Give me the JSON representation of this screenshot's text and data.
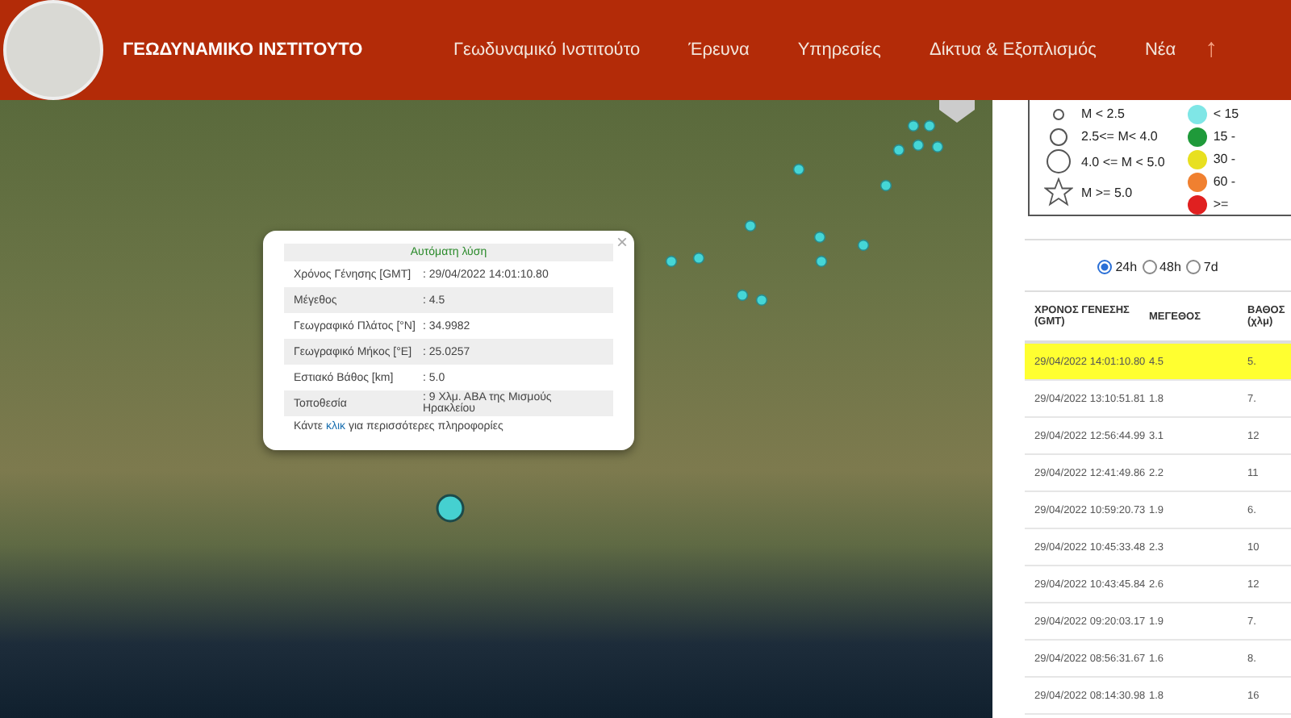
{
  "header": {
    "title": "ΓΕΩΔΥΝΑΜΙΚΟ ΙΝΣΤΙΤΟΥΤΟ",
    "nav": [
      "Γεωδυναμικό Ινστιτούτο",
      "Έρευνα",
      "Υπηρεσίες",
      "Δίκτυα & Εξοπλισμός",
      "Νέα"
    ],
    "up_arrow": "↑"
  },
  "popup": {
    "close": "×",
    "heading": "Αυτόματη λύση",
    "rows": [
      {
        "label": "Χρόνος Γένησης [GMT]",
        "value": ": 29/04/2022 14:01:10.80"
      },
      {
        "label": "Μέγεθος",
        "value": ": 4.5"
      },
      {
        "label": "Γεωγραφικό Πλάτος [°N]",
        "value": ": 34.9982"
      },
      {
        "label": "Γεωγραφικό Μήκος [°E]",
        "value": ": 25.0257"
      },
      {
        "label": "Εστιακό Βάθος [km]",
        "value": ": 5.0"
      },
      {
        "label": "Τοποθεσία",
        "value": ": 9 Χλμ. ΑΒΑ της Μισμούς Ηρακλείου"
      }
    ],
    "footer_before": "Κάντε ",
    "footer_link": "κλικ",
    "footer_after": " για περισσότερες πληροφορίες"
  },
  "legend": {
    "sizes": [
      {
        "kind": "small",
        "label": "M < 2.5"
      },
      {
        "kind": "medium",
        "label": "2.5<= M< 4.0"
      },
      {
        "kind": "large",
        "label": "4.0 <= M < 5.0"
      },
      {
        "kind": "star",
        "label": "M >= 5.0"
      }
    ],
    "depths": [
      {
        "label": "< 15",
        "color": "#7fe6e6"
      },
      {
        "label": "15 -",
        "color": "#1f9a3a"
      },
      {
        "label": "30 -",
        "color": "#e8e020"
      },
      {
        "label": "60 -",
        "color": "#f08030"
      },
      {
        "label": ">=",
        "color": "#e02020"
      }
    ]
  },
  "periods": [
    {
      "label": "24h",
      "selected": true
    },
    {
      "label": "48h",
      "selected": false
    },
    {
      "label": "7d",
      "selected": false
    }
  ],
  "table": {
    "columns": [
      "ΧΡΟΝΟΣ ΓΕΝΕΣΗΣ (GMT)",
      "ΜΕΓΕΘΟΣ",
      "ΒΑΘΟΣ (χλμ)"
    ],
    "rows": [
      {
        "time": "29/04/2022 14:01:10.80",
        "magnitude": "4.5",
        "depth": "5.",
        "selected": true
      },
      {
        "time": "29/04/2022 13:10:51.81",
        "magnitude": "1.8",
        "depth": "7.",
        "selected": false
      },
      {
        "time": "29/04/2022 12:56:44.99",
        "magnitude": "3.1",
        "depth": "12",
        "selected": false
      },
      {
        "time": "29/04/2022 12:41:49.86",
        "magnitude": "2.2",
        "depth": "11",
        "selected": false
      },
      {
        "time": "29/04/2022 10:59:20.73",
        "magnitude": "1.9",
        "depth": "6.",
        "selected": false
      },
      {
        "time": "29/04/2022 10:45:33.48",
        "magnitude": "2.3",
        "depth": "10",
        "selected": false
      },
      {
        "time": "29/04/2022 10:43:45.84",
        "magnitude": "2.6",
        "selected": false,
        "depth": "12"
      },
      {
        "time": "29/04/2022 09:20:03.17",
        "magnitude": "1.9",
        "depth": "7.",
        "selected": false
      },
      {
        "time": "29/04/2022 08:56:31.67",
        "magnitude": "1.6",
        "depth": "8.",
        "selected": false
      },
      {
        "time": "29/04/2022 08:14:30.98",
        "magnitude": "1.8",
        "depth": "16",
        "selected": false
      }
    ]
  }
}
